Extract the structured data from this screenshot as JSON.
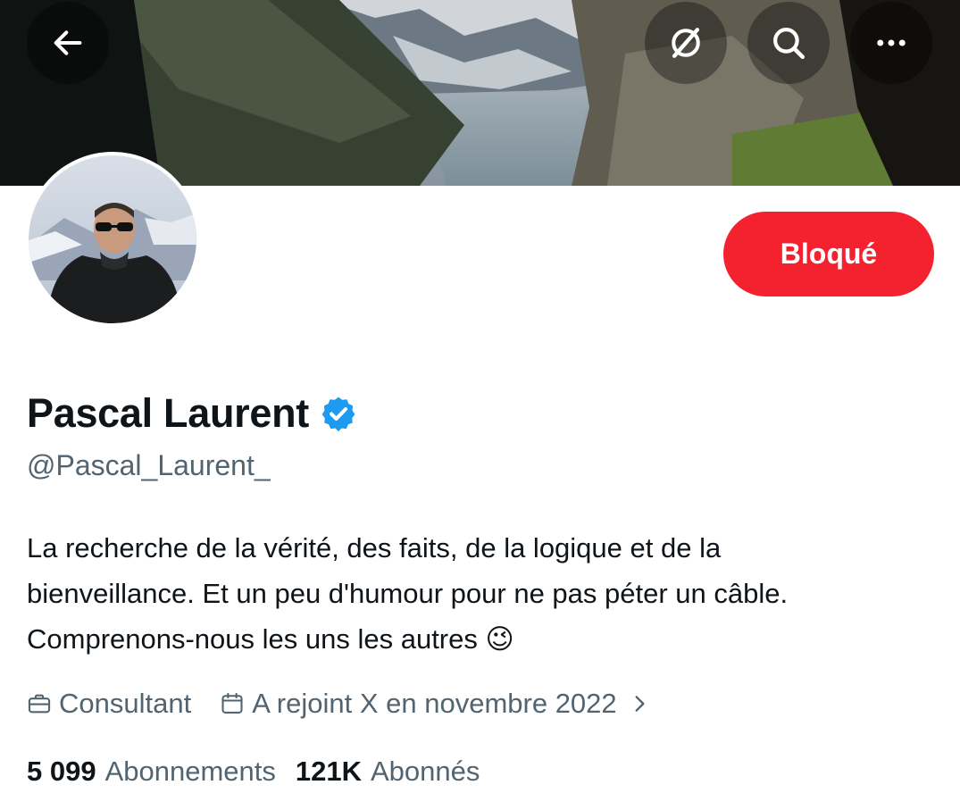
{
  "header": {
    "back_icon": "arrow-left-icon",
    "grok_icon": "grok-icon",
    "search_icon": "search-icon",
    "more_icon": "more-horizontal-icon"
  },
  "profile": {
    "name": "Pascal Laurent",
    "verified": true,
    "verified_color": "#1d9bf0",
    "handle": "@Pascal_Laurent_",
    "block_label": "Bloqué",
    "block_color": "#f4212e",
    "bio": "La recherche de la vérité, des faits, de la logique et de la\nbienveillance. Et un peu d'humour pour ne pas péter un câble.\nComprenons-nous les uns les autres 😉",
    "job": "Consultant",
    "joined": "A rejoint X en novembre 2022"
  },
  "stats": {
    "following_count": "5 099",
    "following_label": "Abonnements",
    "followers_count": "121K",
    "followers_label": "Abonnés"
  }
}
